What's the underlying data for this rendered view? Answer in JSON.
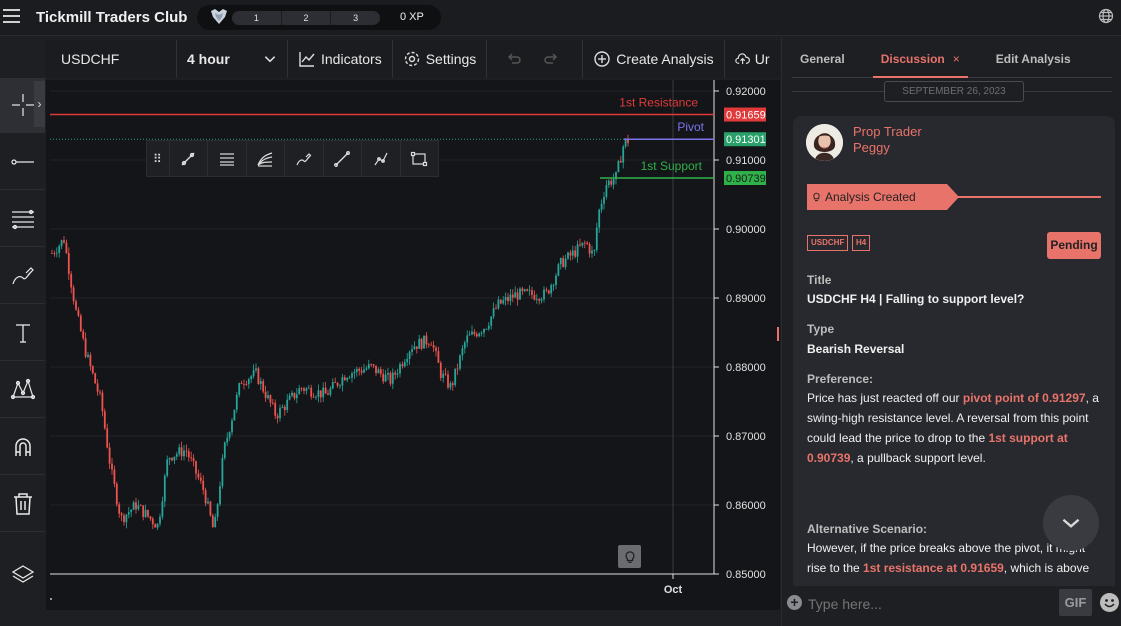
{
  "app": {
    "title": "Tickmill Traders Club",
    "xp_levels": [
      "1",
      "2",
      "3"
    ],
    "xp_text": "0 XP"
  },
  "icons": {
    "menu": "hamburger-icon",
    "globe": "globe-icon",
    "badge": "rank-badge-icon"
  },
  "toolbar": {
    "symbol": "USDCHF",
    "interval": "4 hour",
    "indicators": "Indicators",
    "settings": "Settings",
    "create_analysis": "Create Analysis",
    "upload": "Ur"
  },
  "left_tools": [
    "crosshair-tool",
    "line-tool",
    "fib-tool",
    "brush-tool",
    "text-tool",
    "pattern-tool",
    "magnet-tool",
    "trash-tool",
    "layers-tool"
  ],
  "chart": {
    "levels": [
      {
        "name": "1st Resistance",
        "price": "0.91659",
        "color": "#e03a3a"
      },
      {
        "name": "Pivot",
        "price": "0.91301",
        "color": "#7b74e8"
      },
      {
        "name": "1st Support",
        "price": "0.90739",
        "color": "#2fb14a"
      }
    ],
    "price_axis": [
      "0.92000",
      "0.91000",
      "0.90000",
      "0.89000",
      "0.88000",
      "0.87000",
      "0.86000",
      "0.85000"
    ],
    "price_tags": {
      "resistance": "0.91659",
      "pivot": "0.91301",
      "support": "0.90739"
    },
    "time_label": "Oct",
    "colors": {
      "up": "#26a69a",
      "down": "#ef5350",
      "bg": "#141518"
    }
  },
  "panel": {
    "tabs": [
      "General",
      "Discussion",
      "Edit Analysis"
    ],
    "active_tab": "Discussion",
    "close_glyph": "×",
    "date": "SEPTEMBER 26, 2023",
    "author_role": "Prop Trader",
    "author_name": "Peggy",
    "event": "Analysis Created",
    "tags": [
      "USDCHF",
      "H4"
    ],
    "status": "Pending",
    "title_label": "Title",
    "title_value": "USDCHF H4 | Falling to support level?",
    "type_label": "Type",
    "type_value": "Bearish Reversal",
    "preference_label": "Preference:",
    "pref_1": "Price has just reacted off our ",
    "pref_hl_1": "pivot point of 0.91297",
    "pref_2": ", a swing-high resistance level. A reversal from this point could lead the price to drop to the ",
    "pref_hl_2": "1st support at 0.90739",
    "pref_3": ", a pullback support level.",
    "alt_label": "Alternative Scenario:",
    "alt_1": " However, if the price breaks above the pivot, it might rise to the ",
    "alt_hl_1": "1st resistance at 0.91659",
    "alt_2": ", which is above",
    "chat_placeholder": "Type here...",
    "gif": "GIF"
  }
}
